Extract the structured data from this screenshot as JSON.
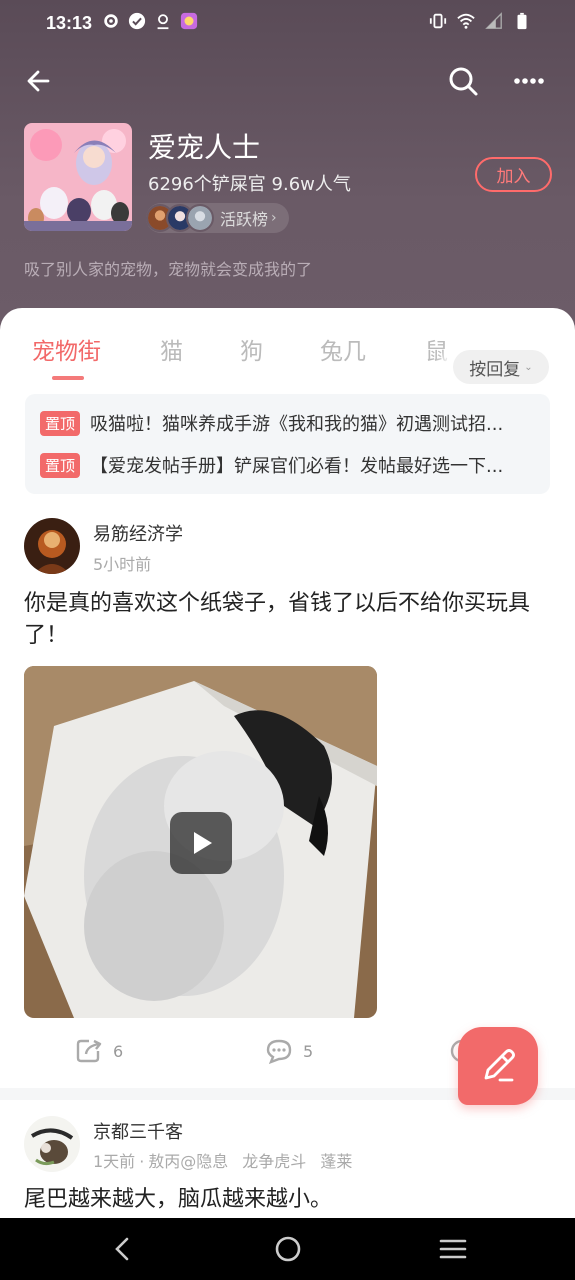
{
  "status_bar": {
    "time": "13:13",
    "left_icons": [
      "settings-icon",
      "check-circle-icon",
      "location-icon",
      "app-notification-icon"
    ],
    "right_icons": [
      "vibrate-icon",
      "wifi-icon",
      "signal-icon",
      "battery-icon"
    ]
  },
  "group": {
    "name": "爱宠人士",
    "stats": "6296个铲屎官 9.6w人气",
    "active_rank_label": "活跃榜",
    "join_label": "加入",
    "description": "吸了别人家的宠物，宠物就会变成我的了"
  },
  "tabs": [
    {
      "label": "宠物街",
      "active": true
    },
    {
      "label": "猫",
      "active": false
    },
    {
      "label": "狗",
      "active": false
    },
    {
      "label": "兔几",
      "active": false
    },
    {
      "label": "鼠",
      "active": false
    }
  ],
  "sort": {
    "label": "按回复"
  },
  "pinned": [
    {
      "badge": "置顶",
      "text": "吸猫啦！猫咪养成手游《我和我的猫》初遇测试招..."
    },
    {
      "badge": "置顶",
      "text": "【爱宠发帖手册】铲屎官们必看！发帖最好选一下..."
    }
  ],
  "posts": [
    {
      "author": "易筋经济学",
      "time": "5小时前",
      "text": "你是真的喜欢这个纸袋子，省钱了以后不给你买玩具了！",
      "has_video": true,
      "shares": "6",
      "comments": "5"
    },
    {
      "author": "京都三千客",
      "time": "1天前",
      "tags": [
        "敖丙@隐息",
        "龙争虎斗",
        "蓬莱"
      ],
      "text": "尾巴越来越大，脑瓜越来越小。"
    }
  ],
  "colors": {
    "accent": "#f26a6a",
    "header_bg": "#5f505c"
  }
}
